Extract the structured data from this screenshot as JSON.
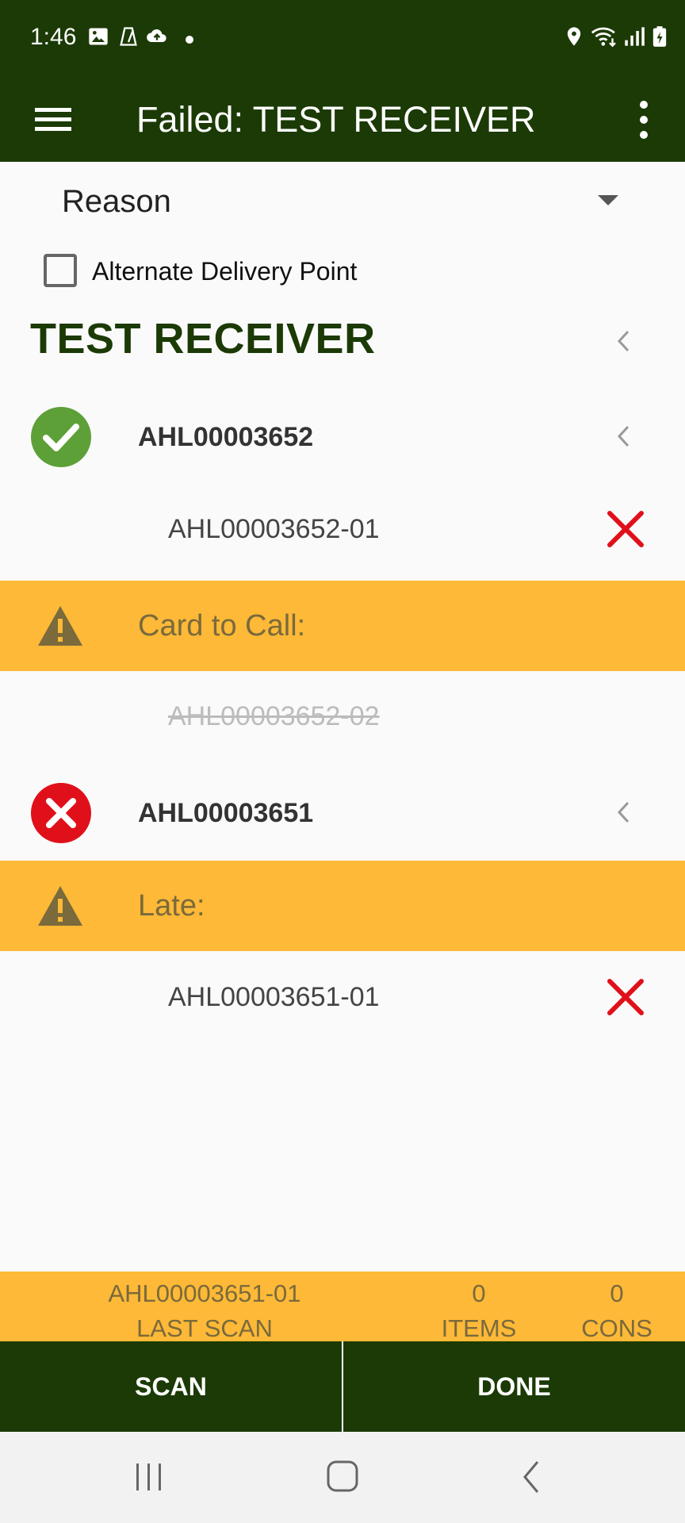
{
  "status_bar": {
    "time": "1:46",
    "icons": [
      "image-icon",
      "metronome-icon",
      "cloud-upload-icon",
      "dot-icon",
      "location-icon",
      "wifi-icon",
      "signal-icon",
      "battery-charging-icon"
    ]
  },
  "app_bar": {
    "title": "Failed: TEST RECEIVER",
    "menu_icon": "hamburger-menu-icon",
    "more_icon": "more-vert-icon",
    "color": "#1b3a05"
  },
  "reason": {
    "label": "Reason"
  },
  "alternate_delivery": {
    "label": "Alternate Delivery Point",
    "checked": false
  },
  "receiver": {
    "name": "TEST RECEIVER"
  },
  "consignments": [
    {
      "id": "AHL00003652",
      "status": "ok",
      "items": [
        {
          "id": "AHL00003652-01",
          "removable": true
        },
        {
          "warning": "Card to Call:"
        },
        {
          "id": "AHL00003652-02",
          "struck": true
        }
      ]
    },
    {
      "id": "AHL00003651",
      "status": "failed",
      "items": [
        {
          "warning": "Late:"
        },
        {
          "id": "AHL00003651-01",
          "removable": true
        }
      ]
    }
  ],
  "summary": {
    "last_scan_value": "AHL00003651-01",
    "last_scan_label": "LAST SCAN",
    "items_value": "0",
    "items_label": "ITEMS",
    "cons_value": "0",
    "cons_label": "CONS"
  },
  "actions": {
    "scan": "SCAN",
    "done": "DONE"
  },
  "colors": {
    "primary": "#1b3a05",
    "warning": "#fdb937",
    "success": "#5da037",
    "error": "#e0101b"
  }
}
